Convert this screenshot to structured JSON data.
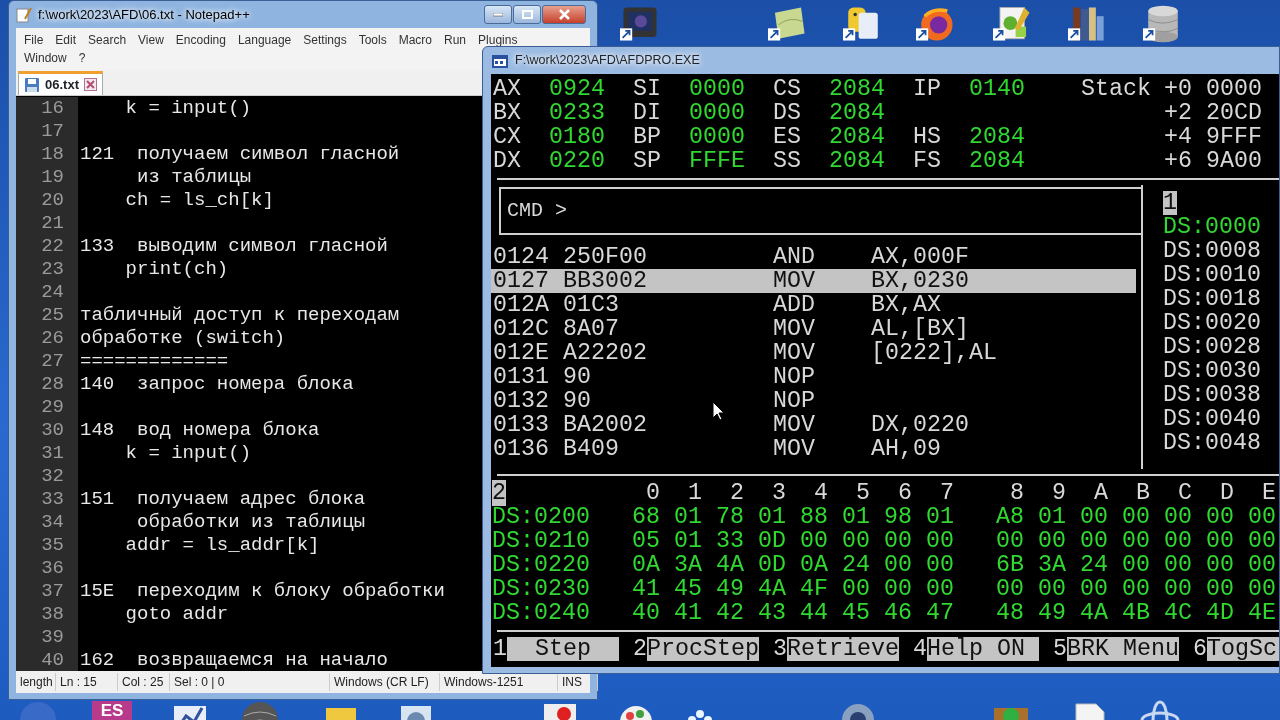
{
  "notepad": {
    "title": "f:\\work\\2023\\AFD\\06.txt - Notepad++",
    "menu": [
      "File",
      "Edit",
      "Search",
      "View",
      "Encoding",
      "Language",
      "Settings",
      "Tools",
      "Macro",
      "Run",
      "Plugins",
      "Window",
      "?"
    ],
    "tabs": [
      {
        "label": "06.txt",
        "selected": true
      }
    ],
    "lines": [
      {
        "number": "16",
        "text": "    k = input()"
      },
      {
        "number": "17"
      },
      {
        "number": "18",
        "text": "121  получаем символ гласной"
      },
      {
        "number": "19",
        "text": "     из таблицы"
      },
      {
        "number": "20",
        "text": "    ch = ls_ch[k]"
      },
      {
        "number": "21"
      },
      {
        "number": "22",
        "text": "133  выводим символ гласной"
      },
      {
        "number": "23",
        "text": "    print(ch)"
      },
      {
        "number": "24"
      },
      {
        "number": "25",
        "text": "табличный доступ к переходам"
      },
      {
        "number": "26",
        "text": "обработке (switch)"
      },
      {
        "number": "27",
        "text": "============="
      },
      {
        "number": "28",
        "text": "140  запрос номера блока"
      },
      {
        "number": "29"
      },
      {
        "number": "30",
        "text": "148  вод номера блока"
      },
      {
        "number": "31",
        "text": "    k = input()"
      },
      {
        "number": "32"
      },
      {
        "number": "33",
        "text": "151  получаем адрес блока"
      },
      {
        "number": "34",
        "text": "     обработки из таблицы"
      },
      {
        "number": "35",
        "text": "    addr = ls_addr[k]"
      },
      {
        "number": "36"
      },
      {
        "number": "37",
        "text": "15E  переходим к блоку обработки"
      },
      {
        "number": "38",
        "text": "    goto addr"
      },
      {
        "number": "39"
      },
      {
        "number": "40",
        "text": "162  возвращаемся на начало"
      }
    ],
    "status": [
      "length",
      "Ln : 15",
      "Col : 25",
      "Sel : 0 | 0",
      "Windows (CR LF)",
      "Windows-1251",
      "INS"
    ]
  },
  "afdpro": {
    "title": "F:\\work\\2023\\AFD\\AFDPRO.EXE",
    "registers": [
      [
        {
          "kind": "register",
          "name": "AX",
          "value": "0924"
        },
        {
          "kind": "register",
          "name": "SI",
          "value": "0000"
        },
        {
          "kind": "register",
          "name": "CS",
          "value": "2084"
        },
        {
          "kind": "register",
          "name": "IP",
          "value": "0140"
        }
      ],
      [
        {
          "kind": "register",
          "name": "BX",
          "value": "0233"
        },
        {
          "kind": "register",
          "name": "DI",
          "value": "0000"
        },
        {
          "kind": "register",
          "name": "DS",
          "value": "2084"
        },
        {
          "kind": "blank"
        }
      ],
      [
        {
          "kind": "register",
          "name": "CX",
          "value": "0180"
        },
        {
          "kind": "register",
          "name": "BP",
          "value": "0000"
        },
        {
          "kind": "register",
          "name": "ES",
          "value": "2084"
        },
        {
          "kind": "register",
          "name": "HS",
          "value": "2084"
        }
      ],
      [
        {
          "kind": "register",
          "name": "DX",
          "value": "0220"
        },
        {
          "kind": "register",
          "name": "SP",
          "value": "FFFE"
        },
        {
          "kind": "register",
          "name": "SS",
          "value": "2084"
        },
        {
          "kind": "register",
          "name": "FS",
          "value": "2084"
        }
      ]
    ],
    "stack_label": "Stack",
    "stack": [
      {
        "offset": "+0",
        "value": "0000"
      },
      {
        "offset": "+2",
        "value": "20CD"
      },
      {
        "offset": "+4",
        "value": "9FFF"
      },
      {
        "offset": "+6",
        "value": "9A00"
      }
    ],
    "cmd_prompt": "CMD >",
    "disassembly": [
      {
        "address": "0124",
        "bytes": "250F00",
        "mnemonic": "AND",
        "operands": "AX,000F",
        "selected": false
      },
      {
        "address": "0127",
        "bytes": "BB3002",
        "mnemonic": "MOV",
        "operands": "BX,0230",
        "selected": true
      },
      {
        "address": "012A",
        "bytes": "01C3",
        "mnemonic": "ADD",
        "operands": "BX,AX",
        "selected": false
      },
      {
        "address": "012C",
        "bytes": "8A07",
        "mnemonic": "MOV",
        "operands": "AL,[BX]",
        "selected": false
      },
      {
        "address": "012E",
        "bytes": "A22202",
        "mnemonic": "MOV",
        "operands": "[0222],AL",
        "selected": false
      },
      {
        "address": "0131",
        "bytes": "90",
        "mnemonic": "NOP",
        "selected": false
      },
      {
        "address": "0132",
        "bytes": "90",
        "mnemonic": "NOP",
        "selected": false
      },
      {
        "address": "0133",
        "bytes": "BA2002",
        "mnemonic": "MOV",
        "operands": "DX,0220",
        "selected": false
      },
      {
        "address": "0136",
        "bytes": "B409",
        "mnemonic": "MOV",
        "operands": "AH,09",
        "selected": false
      }
    ],
    "watch_panel": {
      "number": "1",
      "rows": [
        {
          "text": "DS:0000",
          "selected": true
        },
        {
          "text": "DS:0008",
          "selected": false
        },
        {
          "text": "DS:0010",
          "selected": false
        },
        {
          "text": "DS:0018",
          "selected": false
        },
        {
          "text": "DS:0020",
          "selected": false
        },
        {
          "text": "DS:0028",
          "selected": false
        },
        {
          "text": "DS:0030",
          "selected": false
        },
        {
          "text": "DS:0038",
          "selected": false
        },
        {
          "text": "DS:0040",
          "selected": false
        },
        {
          "text": "DS:0048",
          "selected": false
        }
      ]
    },
    "dump": {
      "number": "2",
      "columns": [
        "0",
        "1",
        "2",
        "3",
        "4",
        "5",
        "6",
        "7",
        "8",
        "9",
        "A",
        "B",
        "C",
        "D",
        "E"
      ],
      "rows": [
        {
          "address": "DS:0200",
          "bytes": [
            "68",
            "01",
            "78",
            "01",
            "88",
            "01",
            "98",
            "01",
            "A8",
            "01",
            "00",
            "00",
            "00",
            "00",
            "00"
          ]
        },
        {
          "address": "DS:0210",
          "bytes": [
            "05",
            "01",
            "33",
            "0D",
            "00",
            "00",
            "00",
            "00",
            "00",
            "00",
            "00",
            "00",
            "00",
            "00",
            "00"
          ]
        },
        {
          "address": "DS:0220",
          "bytes": [
            "0A",
            "3A",
            "4A",
            "0D",
            "0A",
            "24",
            "00",
            "00",
            "6B",
            "3A",
            "24",
            "00",
            "00",
            "00",
            "00"
          ]
        },
        {
          "address": "DS:0230",
          "bytes": [
            "41",
            "45",
            "49",
            "4A",
            "4F",
            "00",
            "00",
            "00",
            "00",
            "00",
            "00",
            "00",
            "00",
            "00",
            "00"
          ]
        },
        {
          "address": "DS:0240",
          "bytes": [
            "40",
            "41",
            "42",
            "43",
            "44",
            "45",
            "46",
            "47",
            "48",
            "49",
            "4A",
            "4B",
            "4C",
            "4D",
            "4E"
          ]
        }
      ]
    },
    "function_keys": [
      {
        "number": "1",
        "label": "Step"
      },
      {
        "number": "2",
        "label": "ProcStep"
      },
      {
        "number": "3",
        "label": "Retrieve"
      },
      {
        "number": "4",
        "label": "Help ON"
      },
      {
        "number": "5",
        "label": "BRK Menu"
      },
      {
        "number": "6",
        "label": "TogSc"
      }
    ]
  },
  "desktop": {
    "bottom_tile": "ES"
  }
}
